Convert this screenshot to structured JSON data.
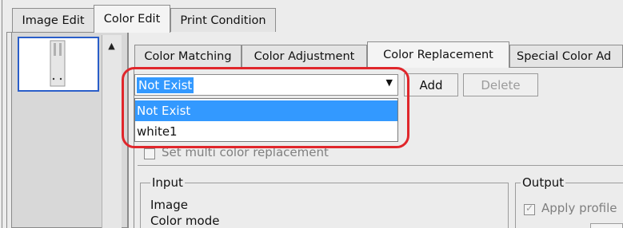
{
  "top_tabs": [
    "Image Edit",
    "Color Edit",
    "Print Condition"
  ],
  "sub_tabs": [
    "Color Matching",
    "Color Adjustment",
    "Color Replacement",
    "Special Color Ad"
  ],
  "combo": {
    "value": "Not Exist"
  },
  "buttons": {
    "add": "Add",
    "delete": "Delete"
  },
  "dropdown_items": [
    "Not Exist",
    "white1"
  ],
  "multi_color": "Set multi color replacement",
  "input_group": {
    "title": "Input",
    "image": "Image",
    "color_mode": "Color mode"
  },
  "output_group": {
    "title": "Output",
    "apply_profile": "Apply profile"
  },
  "colors": {
    "highlight": "#3399ff",
    "callout": "#e0262b",
    "thumb_border": "#2a5ec9"
  },
  "icons": {
    "scroll_up": "▲",
    "combo_arrow": "▼"
  }
}
